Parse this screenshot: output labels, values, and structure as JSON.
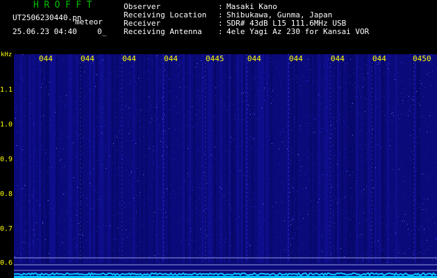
{
  "header": {
    "brand": "HROFFT",
    "filename": "UT2506230440.pn",
    "mode": "meteor",
    "datetime": "25.06.23 04:40",
    "selector": "0_"
  },
  "station": [
    {
      "label": "Observer",
      "sep": ":",
      "value": "Masaki Kano"
    },
    {
      "label": "Receiving Location",
      "sep": ":",
      "value": "Shibukawa, Gunma, Japan"
    },
    {
      "label": "Receiver",
      "sep": ":",
      "value": "SDR# 43dB L15 111.6MHz USB"
    },
    {
      "label": "Receiving Antenna",
      "sep": ":",
      "value": "4ele Yagi Az 230 for Kansai VOR"
    }
  ],
  "axis": {
    "y_unit": "kHz",
    "y_ticks": [
      "1.1",
      "1.0",
      "0.9",
      "0.8",
      "0.7",
      "0.6"
    ],
    "x_ticks": [
      "044",
      "044",
      "044",
      "044",
      "0445",
      "044",
      "044",
      "044",
      "044",
      "0450"
    ]
  },
  "colors": {
    "background": "#000000",
    "spectrogram": "#0a0a7a",
    "noise_line": "#00c8ff",
    "axis_text": "#ffff00",
    "brand": "#00c000"
  }
}
